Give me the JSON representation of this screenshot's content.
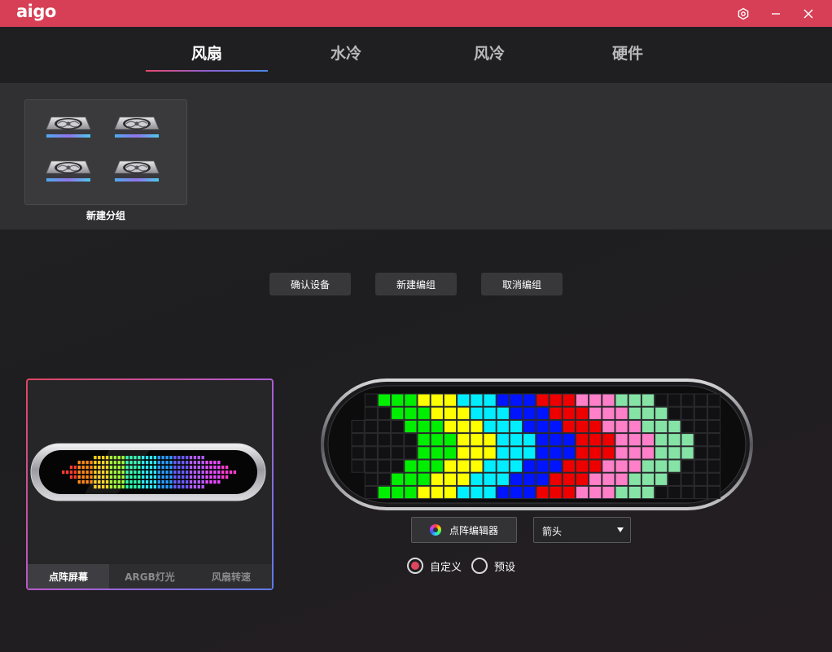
{
  "app": {
    "logo": "aigo"
  },
  "window_controls": [
    {
      "name": "settings-icon"
    },
    {
      "name": "minimize-icon"
    },
    {
      "name": "close-icon"
    }
  ],
  "tabs": [
    "风扇",
    "水冷",
    "风冷",
    "硬件"
  ],
  "active_tab": 0,
  "group": {
    "label": "新建分组",
    "fan_count": 4
  },
  "actions": {
    "confirm": "确认设备",
    "new_group": "新建编组",
    "cancel_group": "取消编组"
  },
  "device_panel": {
    "tabs": [
      "点阵屏幕",
      "ARGB灯光",
      "风扇转速"
    ],
    "active_tab": 0
  },
  "matrix_editor": {
    "button_label": "点阵编辑器",
    "pattern_select": "箭头",
    "mode_options": [
      "自定义",
      "预设"
    ],
    "selected_mode": 0
  },
  "colors": {
    "accent": "#d63f55",
    "matrix_palette": [
      "#00ee00",
      "#ffff00",
      "#00eeff",
      "#0014ff",
      "#ee0000",
      "#ff7fc8",
      "#86e3a6"
    ]
  }
}
